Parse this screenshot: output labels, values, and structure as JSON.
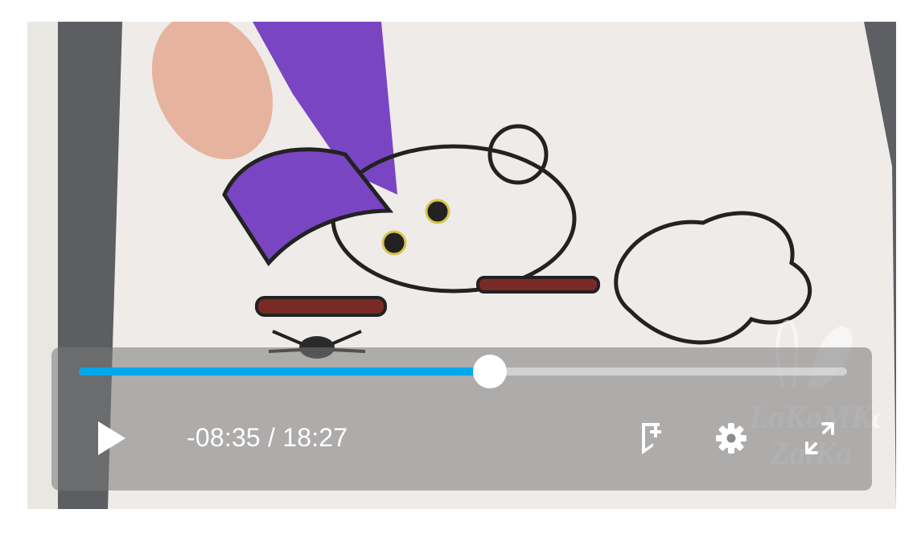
{
  "player": {
    "progress_fraction": 0.535,
    "current_time": "-08:35",
    "time_separator": " / ",
    "duration": "18:27",
    "accent_color": "#00a8ec",
    "icons": {
      "play": "play-icon",
      "add_to_queue": "bookmark-plus-icon",
      "settings": "gear-icon",
      "fullscreen": "fullscreen-expand-icon"
    }
  },
  "watermark": {
    "line1": "LaKoMKa",
    "line2": "ZaiKa"
  }
}
